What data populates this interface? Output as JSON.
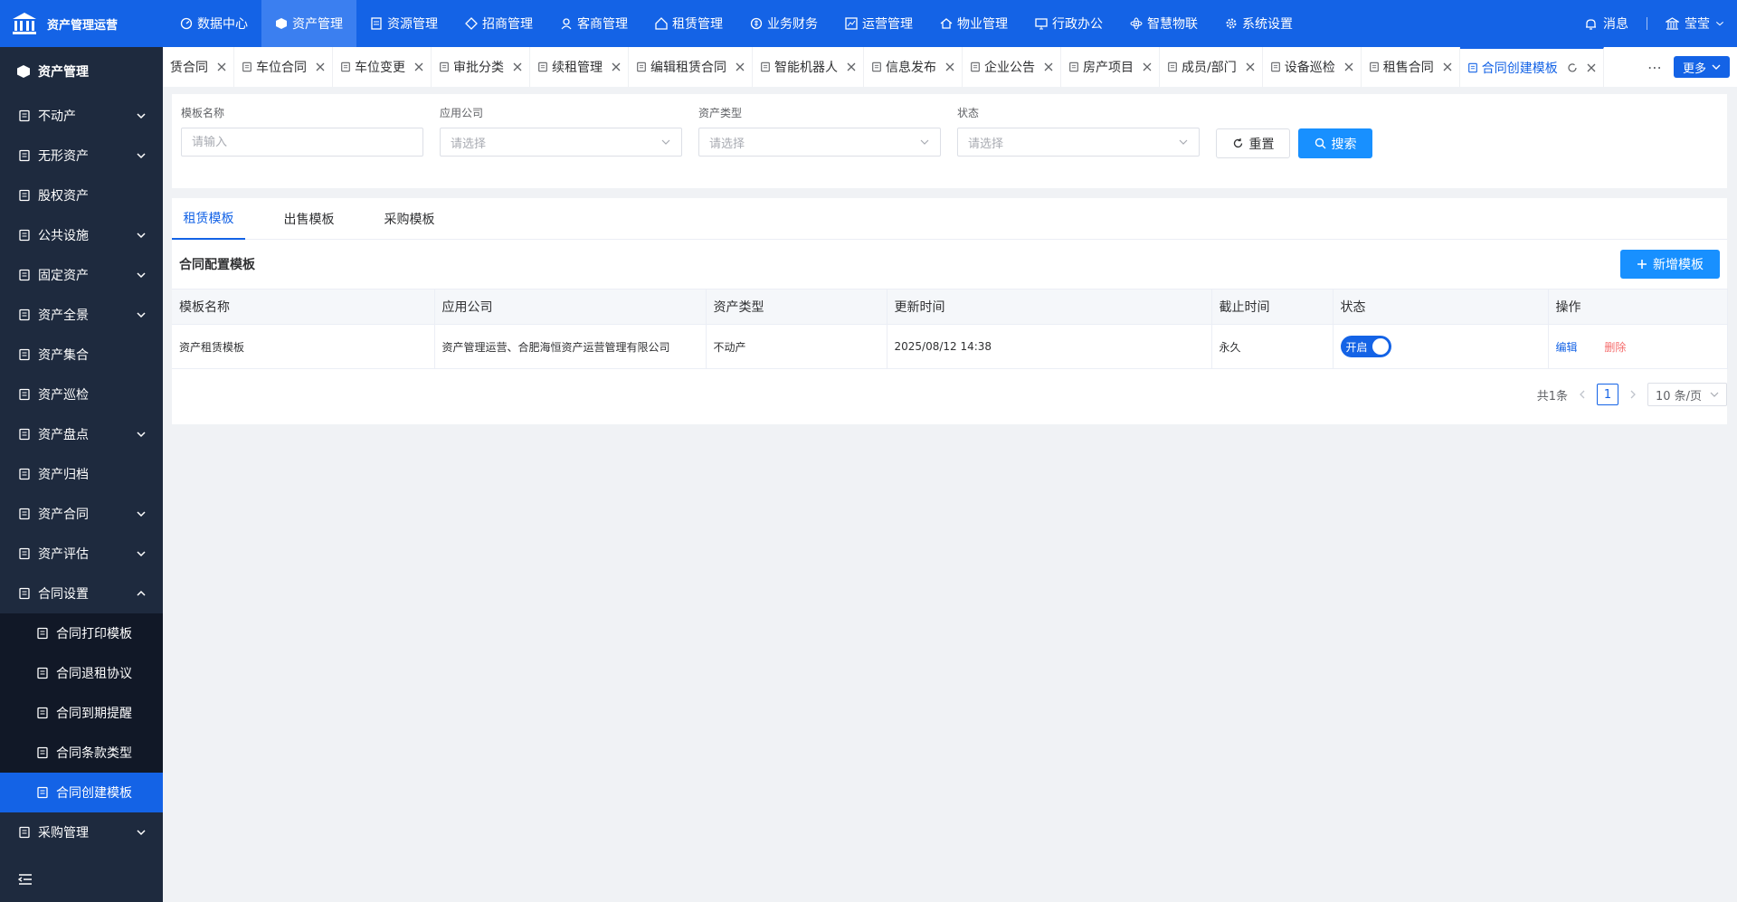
{
  "app": {
    "title": "资产管理运营"
  },
  "topnav": {
    "items": [
      {
        "label": "数据中心",
        "icon": "gauge-icon"
      },
      {
        "label": "资产管理",
        "icon": "cube-icon",
        "active": true
      },
      {
        "label": "资源管理",
        "icon": "document-icon"
      },
      {
        "label": "招商管理",
        "icon": "tag-icon"
      },
      {
        "label": "客商管理",
        "icon": "user-icon"
      },
      {
        "label": "租赁管理",
        "icon": "home-icon"
      },
      {
        "label": "业务财务",
        "icon": "money-icon"
      },
      {
        "label": "运营管理",
        "icon": "chart-icon"
      },
      {
        "label": "物业管理",
        "icon": "house-icon"
      },
      {
        "label": "行政办公",
        "icon": "monitor-icon"
      },
      {
        "label": "智慧物联",
        "icon": "atom-icon"
      },
      {
        "label": "系统设置",
        "icon": "gear-icon"
      }
    ],
    "messages_label": "消息",
    "user_label": "莹莹"
  },
  "sidebar": {
    "header": "资产管理",
    "items": [
      {
        "label": "不动产",
        "icon": "building-icon",
        "expandable": true
      },
      {
        "label": "无形资产",
        "icon": "ledger-icon",
        "expandable": true
      },
      {
        "label": "股权资产",
        "icon": "database-icon",
        "expandable": false
      },
      {
        "label": "公共设施",
        "icon": "office-icon",
        "expandable": true
      },
      {
        "label": "固定资产",
        "icon": "computer-icon",
        "expandable": true
      },
      {
        "label": "资产全景",
        "icon": "picture-icon",
        "expandable": true
      },
      {
        "label": "资产集合",
        "icon": "grid-icon",
        "expandable": false
      },
      {
        "label": "资产巡检",
        "icon": "qrcode-icon",
        "expandable": false
      },
      {
        "label": "资产盘点",
        "icon": "inventory-icon",
        "expandable": true
      },
      {
        "label": "资产归档",
        "icon": "archive-icon",
        "expandable": false
      },
      {
        "label": "资产合同",
        "icon": "contract-icon",
        "expandable": true
      },
      {
        "label": "资产评估",
        "icon": "evaluate-icon",
        "expandable": true
      },
      {
        "label": "合同设置",
        "icon": "settings-doc-icon",
        "expandable": true,
        "expanded": true
      }
    ],
    "sub_items": [
      {
        "label": "合同打印模板",
        "icon": "printer-icon"
      },
      {
        "label": "合同退租协议",
        "icon": "file-icon"
      },
      {
        "label": "合同到期提醒",
        "icon": "clock-file-icon"
      },
      {
        "label": "合同条款类型",
        "icon": "list-file-icon"
      },
      {
        "label": "合同创建模板",
        "icon": "edit-file-icon",
        "active": true
      }
    ],
    "after_items": [
      {
        "label": "采购管理",
        "icon": "cart-icon",
        "expandable": true
      }
    ]
  },
  "tabs": {
    "items": [
      {
        "label": "赁合同",
        "icon": ""
      },
      {
        "label": "车位合同",
        "icon": "car-doc-icon"
      },
      {
        "label": "车位变更",
        "icon": "doc-icon"
      },
      {
        "label": "审批分类",
        "icon": "grid-icon"
      },
      {
        "label": "续租管理",
        "icon": "refresh-icon"
      },
      {
        "label": "编辑租赁合同",
        "icon": "table-icon"
      },
      {
        "label": "智能机器人",
        "icon": "robot-icon"
      },
      {
        "label": "信息发布",
        "icon": "send-icon"
      },
      {
        "label": "企业公告",
        "icon": "speaker-icon"
      },
      {
        "label": "房产项目",
        "icon": "layers-icon"
      },
      {
        "label": "成员/部门",
        "icon": "org-icon"
      },
      {
        "label": "设备巡检",
        "icon": "fingerprint-icon"
      },
      {
        "label": "租售合同",
        "icon": "stack-icon"
      },
      {
        "label": "合同创建模板",
        "icon": "edit-doc-icon",
        "active": true
      }
    ],
    "more_label": "更多"
  },
  "filter": {
    "name_label": "模板名称",
    "name_placeholder": "请输入",
    "company_label": "应用公司",
    "company_placeholder": "请选择",
    "asset_type_label": "资产类型",
    "asset_type_placeholder": "请选择",
    "status_label": "状态",
    "status_placeholder": "请选择",
    "reset_label": "重置",
    "search_label": "搜索"
  },
  "main": {
    "tabs": [
      "租赁模板",
      "出售模板",
      "采购模板"
    ],
    "active_tab": 0,
    "section_title": "合同配置模板",
    "add_label": "新增模板",
    "table": {
      "columns": [
        "模板名称",
        "应用公司",
        "资产类型",
        "更新时间",
        "截止时间",
        "状态",
        "操作"
      ],
      "rows": [
        {
          "name": "资产租赁模板",
          "company": "资产管理运营、合肥海恒资产运营管理有限公司",
          "asset_type": "不动产",
          "updated": "2025/08/12 14:38",
          "deadline": "永久",
          "status": "开启",
          "edit": "编辑",
          "delete": "删除"
        }
      ]
    },
    "pager": {
      "total": "共1条",
      "page": "1",
      "page_size": "10 条/页"
    }
  },
  "colors": {
    "primary": "#1463e6",
    "sidebar_bg": "#1e2a3e",
    "danger": "#f56c6c"
  }
}
